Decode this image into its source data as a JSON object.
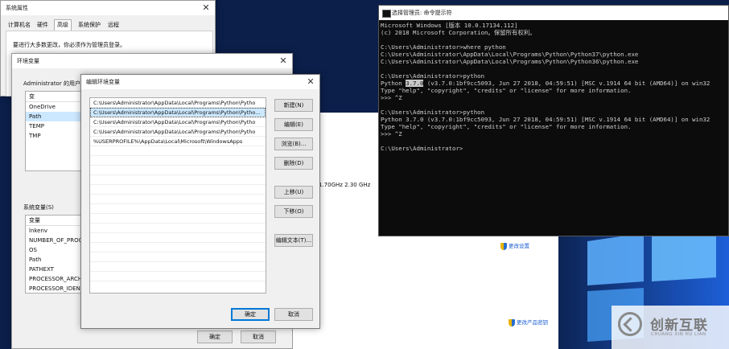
{
  "system_properties": {
    "title": "系统属性",
    "tabs": [
      "计算机名",
      "硬件",
      "高级",
      "系统保护",
      "远程"
    ],
    "admin_note": "要进行大多数更改，你必须作为管理员登录。"
  },
  "env_vars": {
    "title": "环境变量",
    "user_section_label": "Administrator 的用户变",
    "user_column_header": "变",
    "user_vars": [
      "OneDrive",
      "Path",
      "TEMP",
      "TMP"
    ],
    "system_section_label": "系统变量(S)",
    "system_column_header": "变量",
    "system_vars": [
      "lnkenv",
      "NUMBER_OF_PROCE",
      "OS",
      "Path",
      "PATHEXT",
      "PROCESSOR_ARCHI",
      "PROCESSOR_IDENT"
    ],
    "ok_label": "确定",
    "cancel_label": "取消"
  },
  "edit_env": {
    "title": "编辑环境变量",
    "paths": [
      "C:\\Users\\Administrator\\AppData\\Local\\Programs\\Python\\Pytho",
      "C:\\Users\\Administrator\\AppData\\Local\\Programs\\Python\\Pytho...",
      "C:\\Users\\Administrator\\AppData\\Local\\Programs\\Python\\Pytho",
      "C:\\Users\\Administrator\\AppData\\Local\\Programs\\Python\\Pytho",
      "%USERPROFILE%\\AppData\\Local\\Microsoft\\WindowsApps"
    ],
    "selected_index": 1,
    "buttons": {
      "new": "新建(N)",
      "edit": "编辑(E)",
      "browse": "浏览(B)...",
      "delete": "删除(D)",
      "move_up": "上移(U)",
      "move_down": "下移(O)",
      "edit_text": "编辑文本(T)...",
      "ok": "确定",
      "cancel": "取消"
    }
  },
  "background": {
    "cpu_info": "1.70GHz   2.30 GHz",
    "change_settings": "更改设置",
    "change_product_key": "更改产品密钥"
  },
  "console": {
    "title": "选择管理员: 命令提示符",
    "lines": [
      "Microsoft Windows [版本 10.0.17134.112]",
      "(c) 2018 Microsoft Corporation。保留所有权利。",
      "",
      "C:\\Users\\Administrator>where python",
      "C:\\Users\\Administrator\\AppData\\Local\\Programs\\Python\\Python37\\python.exe",
      "C:\\Users\\Administrator\\AppData\\Local\\Programs\\Python\\Python36\\python.exe",
      "",
      "C:\\Users\\Administrator>python",
      "Python 3.7.0 (v3.7.0:1bf9cc5093, Jun 27 2018, 04:59:51) [MSC v.1914 64 bit (AMD64)] on win32",
      "Type \"help\", \"copyright\", \"credits\" or \"license\" for more information.",
      ">>> ^Z",
      "",
      "C:\\Users\\Administrator>python",
      "Python 3.7.0 (v3.7.0:1bf9cc5093, Jun 27 2018, 04:59:51) [MSC v.1914 64 bit (AMD64)] on win32",
      "Type \"help\", \"copyright\", \"credits\" or \"license\" for more information.",
      ">>> ^Z",
      "",
      "C:\\Users\\Administrator>"
    ],
    "selected_fragment": "3.7.0"
  },
  "watermark": {
    "brand": "创新互联",
    "sub": "CHUANG XIN HU LIAN"
  },
  "colors": {
    "desktop": "#0c2353",
    "accent": "#0078d7",
    "console_bg": "#0c0c0c"
  }
}
